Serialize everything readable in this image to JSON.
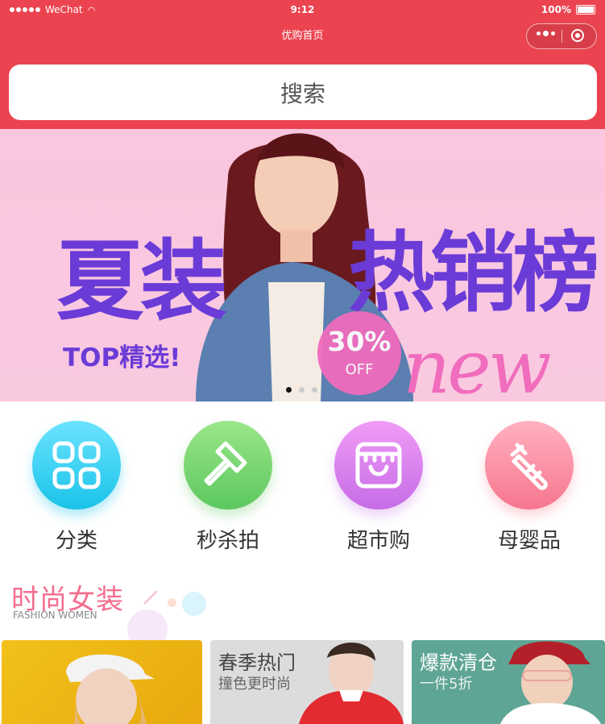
{
  "status_bar": {
    "carrier": "WeChat",
    "time": "9:12",
    "battery": "100%"
  },
  "nav": {
    "title": "优购首页"
  },
  "search": {
    "placeholder": "搜索"
  },
  "banner": {
    "headline_left": "夏装",
    "headline_right": "热销榜",
    "tagline": "TOP精选!",
    "promo_percent": "30%",
    "promo_off": "OFF",
    "script_text": "new",
    "active_index": 0,
    "count": 3
  },
  "categories": [
    {
      "label": "分类",
      "icon": "grid-icon"
    },
    {
      "label": "秒杀拍",
      "icon": "hammer-icon"
    },
    {
      "label": "超市购",
      "icon": "store-icon"
    },
    {
      "label": "母婴品",
      "icon": "baby-bottle-icon"
    }
  ],
  "section": {
    "title": "时尚女装",
    "subtitle": "FASHION WOMEN"
  },
  "products": [
    {
      "title": "",
      "subtitle": ""
    },
    {
      "title": "春季热门",
      "subtitle": "撞色更时尚"
    },
    {
      "title": "爆款清仓",
      "subtitle": "一件5折"
    }
  ],
  "colors": {
    "brand_red": "#eb4450",
    "accent_pink": "#f56d8e",
    "banner_purple": "#6b3bd7"
  }
}
